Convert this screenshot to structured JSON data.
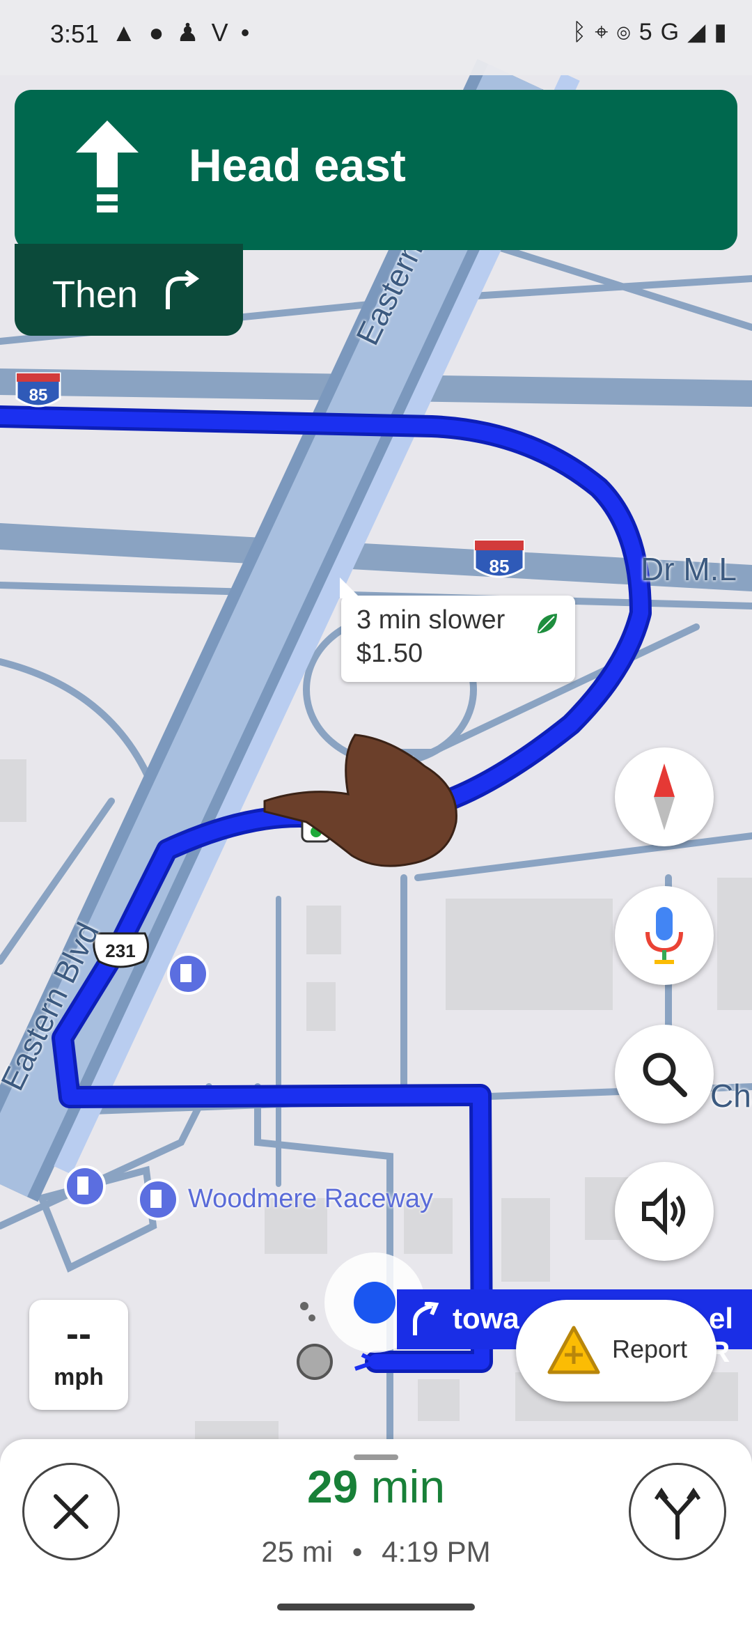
{
  "status_bar": {
    "time": "3:51",
    "left_icons": [
      "navigation-icon",
      "chat-icon",
      "snapchat-icon",
      "venmo-icon",
      "dot-icon"
    ],
    "network": "5G",
    "right_icons": [
      "bluetooth-icon",
      "location-icon",
      "hotspot-icon",
      "signal-icon",
      "battery-icon"
    ]
  },
  "direction": {
    "instruction": "Head east",
    "then_label": "Then"
  },
  "map": {
    "road_labels": [
      "Eastern Blvd",
      "Eastern Blvd",
      "Dr M.L",
      "Cha"
    ],
    "shields": [
      "85",
      "85",
      "231"
    ],
    "poi": "Woodmere Raceway",
    "alt_route_callout": {
      "delay": "3 min slower",
      "toll": "$1.50"
    }
  },
  "turn_banner": {
    "text": "towa",
    "text2": "el R"
  },
  "speed": {
    "value": "--",
    "unit": "mph"
  },
  "report_button": {
    "label": "Report"
  },
  "trip": {
    "duration_value": "29",
    "duration_unit": "min",
    "distance": "25 mi",
    "separator": "•",
    "arrival": "4:19 PM"
  },
  "colors": {
    "nav_green": "#00684e",
    "route_blue": "#1a2ee6",
    "eta_green": "#188038"
  }
}
